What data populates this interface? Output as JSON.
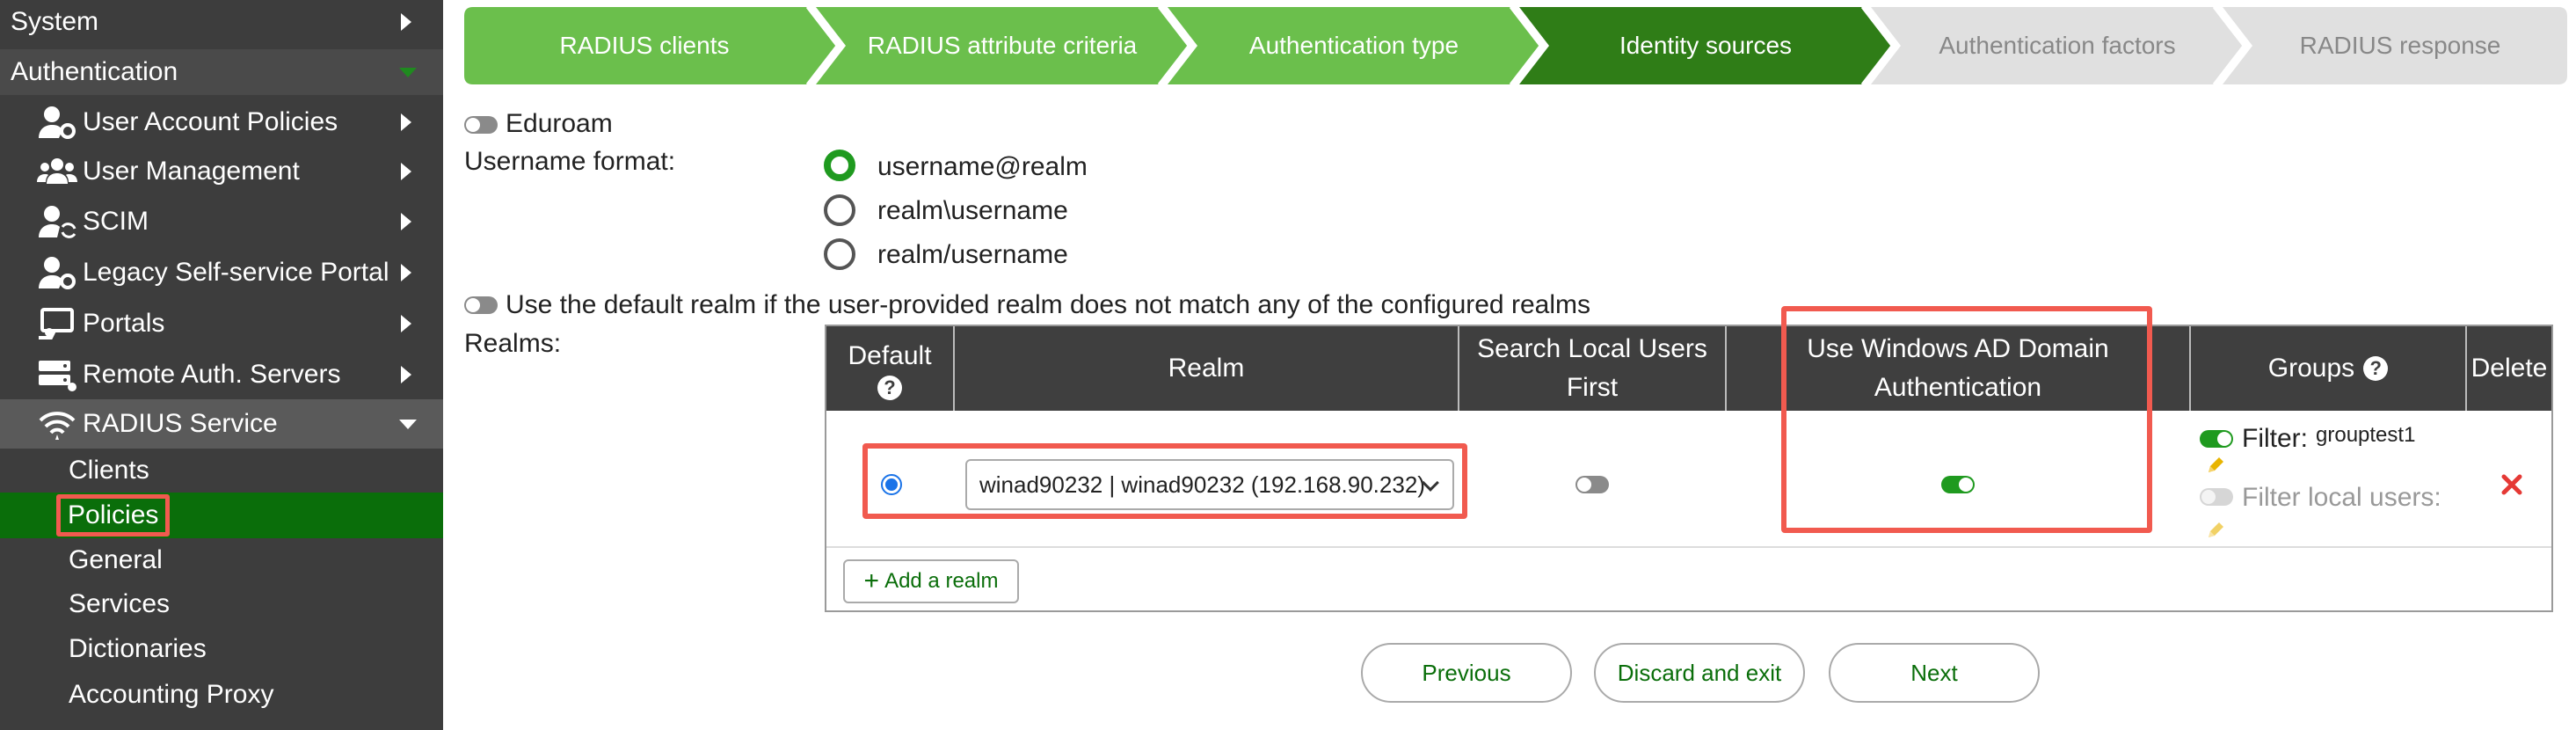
{
  "sidebar": {
    "system": "System",
    "authentication": "Authentication",
    "items": [
      {
        "label": "User Account Policies",
        "icon": "user-cog-icon"
      },
      {
        "label": "User Management",
        "icon": "users-icon"
      },
      {
        "label": "SCIM",
        "icon": "user-sync-icon"
      },
      {
        "label": "Legacy Self-service Portal",
        "icon": "user-cog-icon"
      },
      {
        "label": "Portals",
        "icon": "portal-icon"
      },
      {
        "label": "Remote Auth. Servers",
        "icon": "servers-icon"
      },
      {
        "label": "RADIUS Service",
        "icon": "radius-wifi-icon"
      }
    ],
    "radius_sub": [
      "Clients",
      "Policies",
      "General",
      "Services",
      "Dictionaries",
      "Accounting Proxy"
    ]
  },
  "stepper": {
    "steps": [
      {
        "label": "RADIUS clients",
        "state": "done"
      },
      {
        "label": "RADIUS attribute criteria",
        "state": "done"
      },
      {
        "label": "Authentication type",
        "state": "done"
      },
      {
        "label": "Identity sources",
        "state": "current"
      },
      {
        "label": "Authentication factors",
        "state": "todo"
      },
      {
        "label": "RADIUS response",
        "state": "todo"
      }
    ]
  },
  "form": {
    "eduroam": "Eduroam",
    "username_format_label": "Username format:",
    "username_formats": [
      "username@realm",
      "realm\\username",
      "realm/username"
    ],
    "default_realm_toggle": "Use the default realm if the user-provided realm does not match any of the configured realms",
    "realms_label": "Realms:"
  },
  "table": {
    "headers": {
      "default": "Default",
      "realm": "Realm",
      "search_local_1": "Search Local Users",
      "search_local_2": "First",
      "windows_ad_1": "Use Windows AD Domain",
      "windows_ad_2": "Authentication",
      "groups": "Groups",
      "delete": "Delete"
    },
    "row": {
      "realm_value": "winad90232 | winad90232 (192.168.90.232)",
      "filter_label": "Filter:",
      "filter_value": "grouptest1",
      "filter_local_label": "Filter local users:"
    },
    "add_realm": "Add a realm"
  },
  "footer": {
    "previous": "Previous",
    "discard": "Discard and exit",
    "next": "Next"
  },
  "colors": {
    "accent_green": "#0a6e0a",
    "step_done": "#6bbf4c",
    "step_current": "#2f7d17",
    "step_todo": "#e0e0e0",
    "highlight_red": "#f15a4f",
    "delete_red": "#e53935"
  }
}
